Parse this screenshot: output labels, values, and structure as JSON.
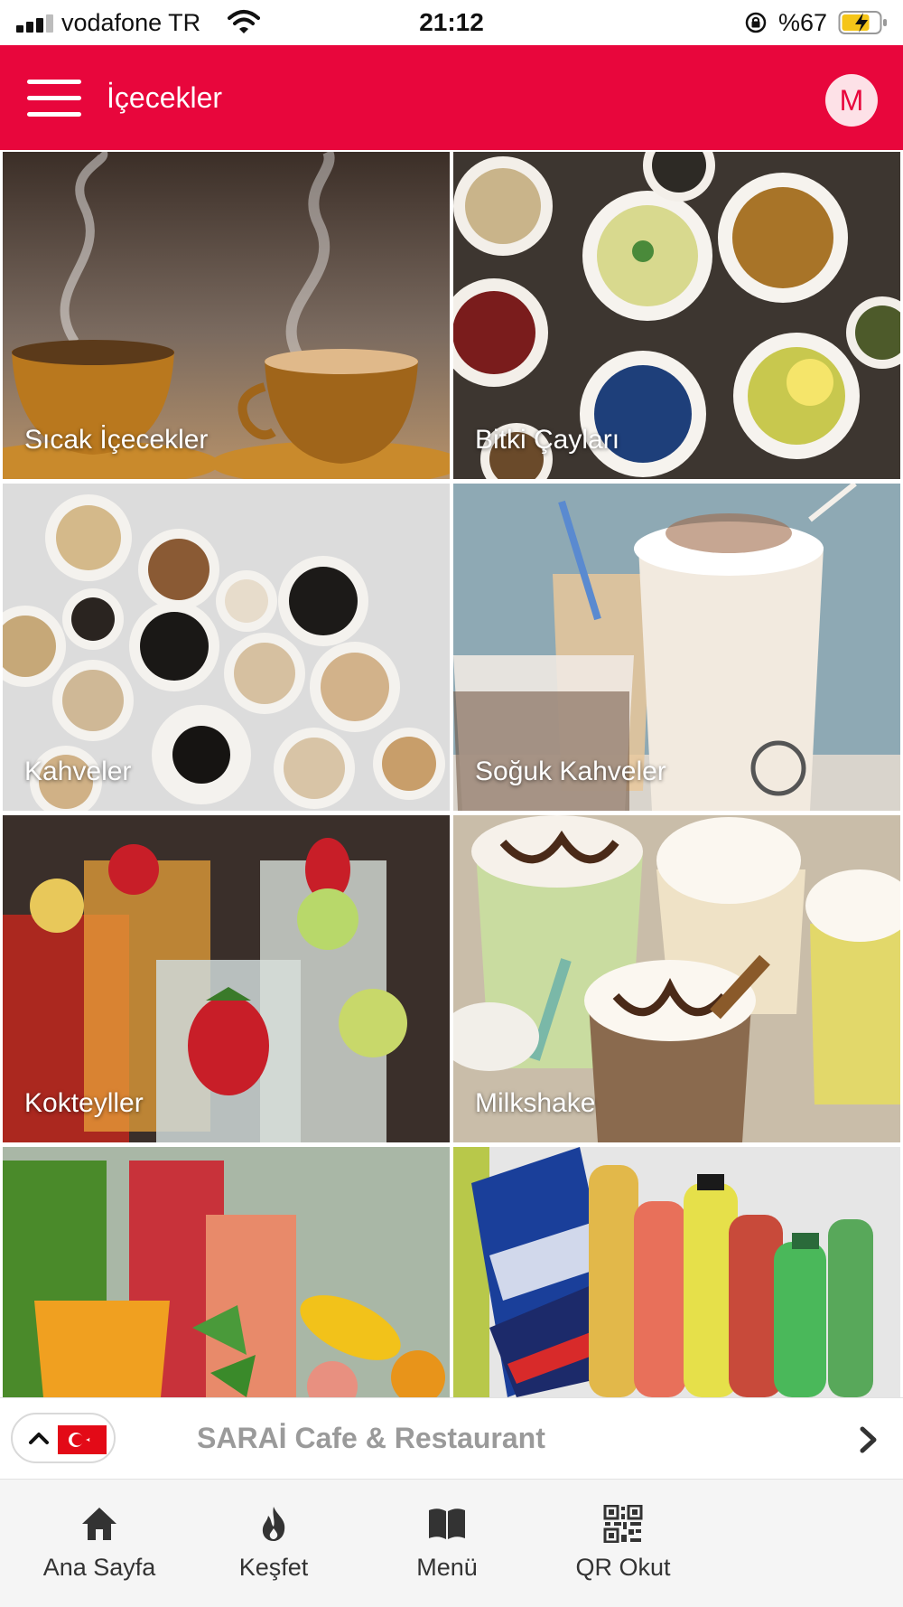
{
  "status_bar": {
    "carrier": "vodafone TR",
    "time": "21:12",
    "battery": "%67"
  },
  "header": {
    "title": "İçecekler",
    "avatar_initial": "M",
    "menu_icon": "hamburger-icon",
    "accent_color": "#e8063c"
  },
  "categories": [
    {
      "label": "Sıcak İçecekler"
    },
    {
      "label": "Bitki Çayları"
    },
    {
      "label": "Kahveler"
    },
    {
      "label": "Soğuk Kahveler"
    },
    {
      "label": "Kokteyller"
    },
    {
      "label": "Milkshake"
    },
    {
      "label": ""
    },
    {
      "label": ""
    }
  ],
  "restaurant_bar": {
    "name": "SARAİ Cafe & Restaurant",
    "language_flag": "turkey-flag-icon"
  },
  "bottom_nav": [
    {
      "label": "Ana Sayfa",
      "icon": "home-icon"
    },
    {
      "label": "Keşfet",
      "icon": "flame-icon"
    },
    {
      "label": "Menü",
      "icon": "book-icon"
    },
    {
      "label": "QR Okut",
      "icon": "qr-code-icon"
    }
  ]
}
